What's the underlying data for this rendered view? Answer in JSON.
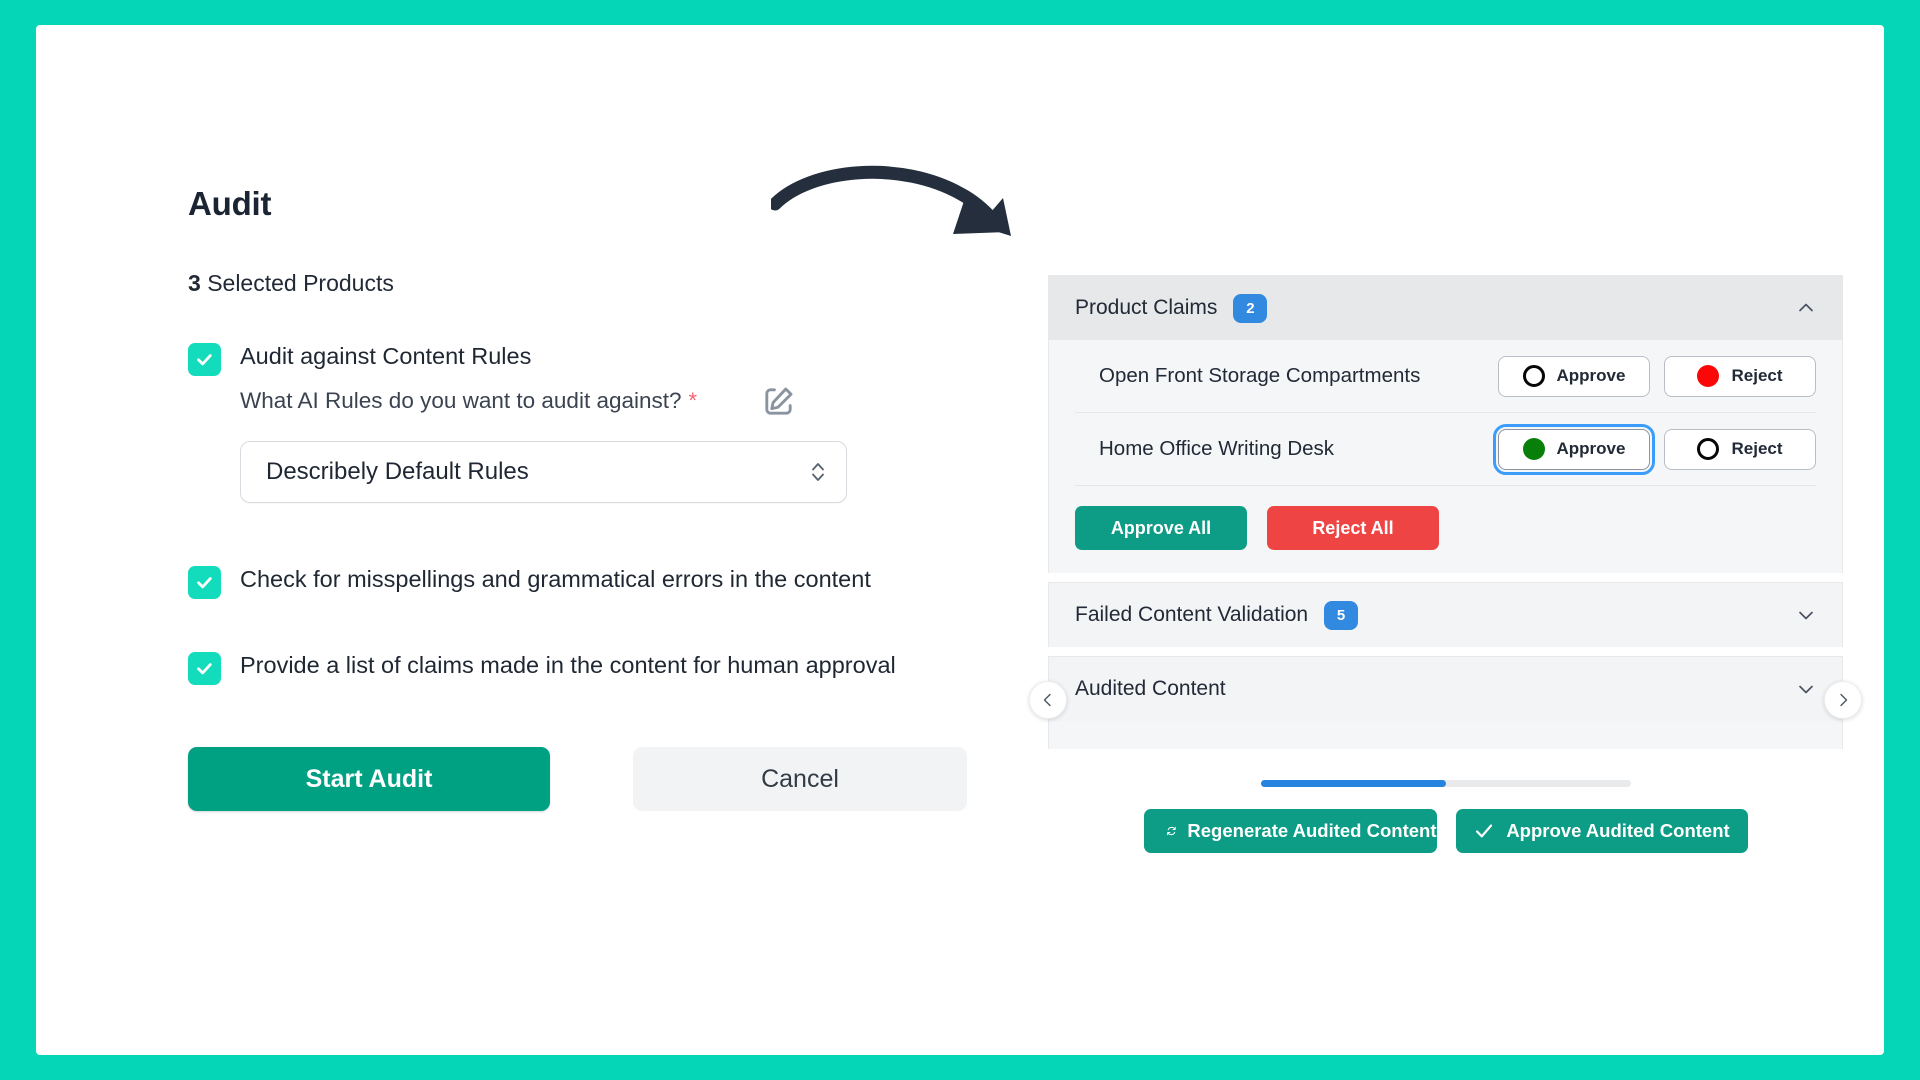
{
  "theme": {
    "page_border": "#05D6B8",
    "primary_teal": "#00A182",
    "accent_teal": "#0D9C85",
    "checkbox_green": "#12DCBB",
    "badge_blue": "#3189E0",
    "danger_red": "#EF4444",
    "reject_dot_red": "#FB0707",
    "approve_dot_green": "#087F08",
    "focus_ring_blue": "#3B9DFB",
    "required_star_red": "#F9616F",
    "scrollbar_blue": "#2684DF",
    "arrow_navy": "#242E3D"
  },
  "left": {
    "page_title": "Audit",
    "selected_products_count": "3",
    "selected_products_label": "Selected Products",
    "options": [
      {
        "label": "Audit against Content Rules",
        "checked": true,
        "sub_question": "What AI Rules do you want to audit against?",
        "required_marker": "*",
        "select_value": "Describely Default Rules",
        "edit_icon": "edit-pencil-square-icon",
        "stepper_icon": "chevron-up-down-icon"
      },
      {
        "label": "Check for misspellings and grammatical errors in the content",
        "checked": true
      },
      {
        "label": "Provide a list of claims made in the content for human approval",
        "checked": true
      }
    ],
    "buttons": {
      "start_audit": "Start Audit",
      "cancel": "Cancel"
    }
  },
  "right": {
    "sections": [
      {
        "title": "Product Claims",
        "badge": "2",
        "expanded": true,
        "chevron": "chevron-up-icon"
      },
      {
        "title": "Failed Content Validation",
        "badge": "5",
        "expanded": false,
        "chevron": "chevron-down-icon"
      },
      {
        "title": "Audited Content",
        "badge": "",
        "expanded": false,
        "chevron": "chevron-down-icon"
      }
    ],
    "claims": [
      {
        "name": "Open Front Storage Compartments",
        "approve_label": "Approve",
        "reject_label": "Reject",
        "approve_state": "unselected",
        "reject_state": "selected",
        "focused": "none"
      },
      {
        "name": "Home Office Writing Desk",
        "approve_label": "Approve",
        "reject_label": "Reject",
        "approve_state": "selected",
        "reject_state": "unselected",
        "focused": "approve"
      }
    ],
    "bulk": {
      "approve_all": "Approve All",
      "reject_all": "Reject All"
    },
    "carousel": {
      "prev_icon": "chevron-left-icon",
      "next_icon": "chevron-right-icon"
    },
    "scrollbar": {
      "progress_percent": "50"
    },
    "footer": {
      "regenerate_label": "Regenerate Audited Content",
      "regenerate_icon": "refresh-icon",
      "approve_label": "Approve Audited Content",
      "approve_icon": "check-icon"
    }
  }
}
